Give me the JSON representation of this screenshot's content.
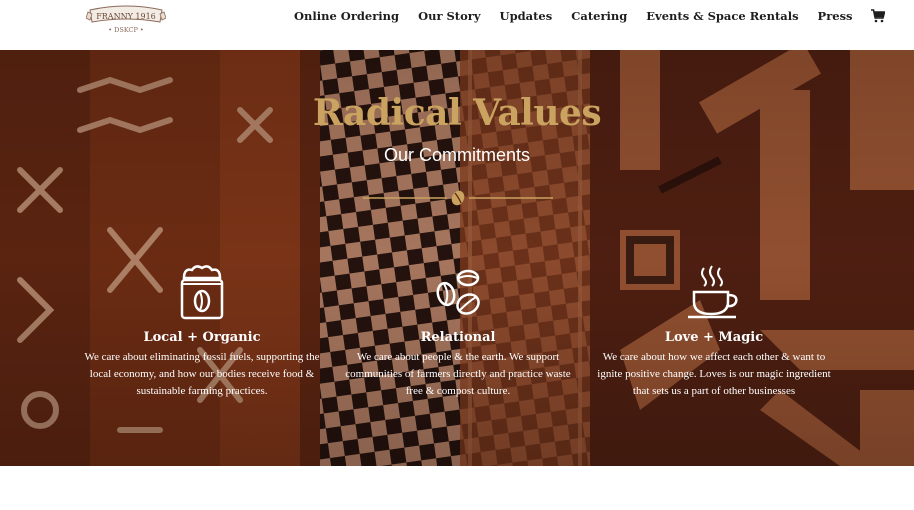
{
  "header": {
    "logo_text_top": "FRANNY 1916",
    "logo_text_bottom": "• DSKCP •",
    "nav": [
      {
        "label": "Online Ordering"
      },
      {
        "label": "Our Story"
      },
      {
        "label": "Updates"
      },
      {
        "label": "Catering"
      },
      {
        "label": "Events & Space Rentals"
      },
      {
        "label": "Press"
      }
    ],
    "cart_icon": "shopping-cart-icon"
  },
  "hero": {
    "title": "Radical Values",
    "subtitle": "Our Commitments",
    "divider_icon": "coffee-bean-icon",
    "colors": {
      "title_gold": "#c9a35f",
      "bg_rust": "#8a3a1c",
      "bg_dark": "#3a1a12",
      "text": "#ffffff"
    },
    "columns": [
      {
        "icon": "coffee-bag-icon",
        "title": "Local + Organic",
        "text": "We care about eliminating fossil fuels, supporting the local economy, and how our bodies receive food & sustainable farming practices."
      },
      {
        "icon": "coffee-beans-icon",
        "title": "Relational",
        "text": "We care about people & the earth. We support communities of farmers directly and practice waste free & compost culture."
      },
      {
        "icon": "coffee-cup-icon",
        "title": "Love + Magic",
        "text": "We care about how we affect each other & want to ignite positive change. Loves is our magic ingredient that sets us a part of other businesses"
      }
    ]
  }
}
